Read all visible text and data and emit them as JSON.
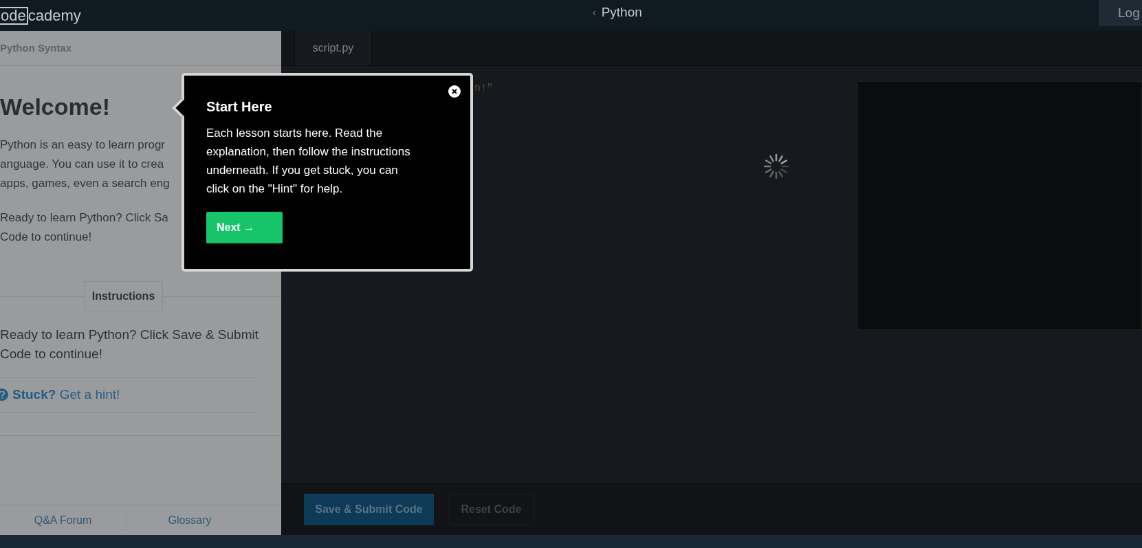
{
  "top_bar": {
    "logo": {
      "boxed": "ode",
      "rest": "cademy"
    },
    "back_caret": "‹",
    "course_title": "Python",
    "login_button": "Log"
  },
  "lesson_panel": {
    "section_title": "Python Syntax",
    "heading": "Welcome!",
    "paragraphs": [
      [
        "Python is an easy to learn progr",
        "anguage. You can use it to crea",
        "apps, games, even a search eng"
      ],
      [
        "Ready to learn Python? Click Sa",
        "Code to continue!"
      ]
    ],
    "instructions_tab": "Instructions",
    "instructions_text": "Ready to learn Python? Click Save & Submit\nCode to continue!",
    "hint": {
      "bold": "Stuck?",
      "link": "Get a hint!"
    },
    "footer_links": [
      "Q&A Forum",
      "Glossary"
    ]
  },
  "editor": {
    "tabs": [
      {
        "label": "script.py",
        "selected": true
      }
    ],
    "code_fragment": "n!\"",
    "output_loading": true,
    "buttons": [
      {
        "label": "Save & Submit Code",
        "kind": "primary"
      },
      {
        "label": "Reset Code",
        "kind": "secondary"
      }
    ]
  },
  "popover": {
    "title": "Start Here",
    "body": "Each lesson starts here. Read the\nexplanation, then follow the instructions\nunderneath. If you get stuck, you can\nclick on the \"Hint\" for help.",
    "next_button": "Next →"
  }
}
